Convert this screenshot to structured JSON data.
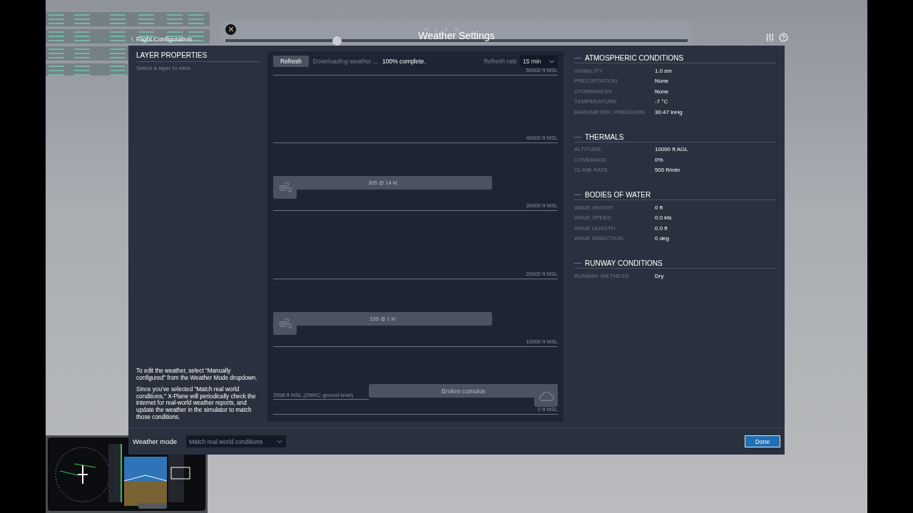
{
  "replay_bar": {
    "level": 0.24
  },
  "header": {
    "back_link": "Flight Configuration",
    "title": "Weather Settings"
  },
  "layer_properties": {
    "title": "LAYER PROPERTIES",
    "hint": "Select a layer to view.",
    "notes": [
      "To edit the weather, select “Manually configured” from the Weather Mode dropdown.",
      "Since you’ve selected “Match real world conditions,” X-Plane will periodically check the internet for real-world weather reports, and update the weather in the simulator to match those conditions."
    ]
  },
  "download": {
    "button": "Refresh",
    "status": "Downloading weather ...",
    "progress": "100% complete.",
    "refresh_rate_label": "Refresh rate",
    "refresh_rate": "15 min"
  },
  "altitude_rows": [
    {
      "altitude": "50000 ft MSL"
    },
    {
      "altitude": "40000 ft MSL"
    },
    {
      "altitude": "30000 ft MSL",
      "wind_layer": "305 @ 14 kt"
    },
    {
      "altitude": "20000 ft MSL"
    },
    {
      "altitude": "10000 ft MSL",
      "wind_layer": "335 @ 1 kt"
    },
    {
      "altitude": "0 ft MSL",
      "ground_level": "3998 ft MSL (ZWKC ground level)",
      "cloud_layer": "Broken cumulus"
    }
  ],
  "sections": [
    {
      "title": "ATMOSPHERIC CONDITIONS",
      "rows": [
        {
          "label": "VISIBILITY",
          "value": "1.0 sm"
        },
        {
          "label": "PRECIPITATION",
          "value": "None"
        },
        {
          "label": "STORMINESS",
          "value": "None"
        },
        {
          "label": "TEMPERATURE",
          "value": "-7 °C"
        },
        {
          "label": "BAROMETRIC PRESSURE",
          "value": "30.47 inHg"
        }
      ]
    },
    {
      "title": "THERMALS",
      "rows": [
        {
          "label": "ALTITUDE",
          "value": "10000 ft AGL"
        },
        {
          "label": "COVERAGE",
          "value": "0%"
        },
        {
          "label": "CLIMB RATE",
          "value": "500 ft/min"
        }
      ]
    },
    {
      "title": "BODIES OF WATER",
      "rows": [
        {
          "label": "WAVE HEIGHT",
          "value": "0 ft"
        },
        {
          "label": "WAVE SPEED",
          "value": "0.0 kts"
        },
        {
          "label": "WAVE LENGTH",
          "value": "0.0 ft"
        },
        {
          "label": "WAVE DIRECTION",
          "value": "0 deg"
        }
      ]
    },
    {
      "title": "RUNWAY CONDITIONS",
      "rows": [
        {
          "label": "RUNWAY WETNESS",
          "value": "Dry"
        }
      ]
    }
  ],
  "weather_mode": {
    "label": "Weather mode",
    "value": "Match real world conditions"
  },
  "done_button": "Done"
}
